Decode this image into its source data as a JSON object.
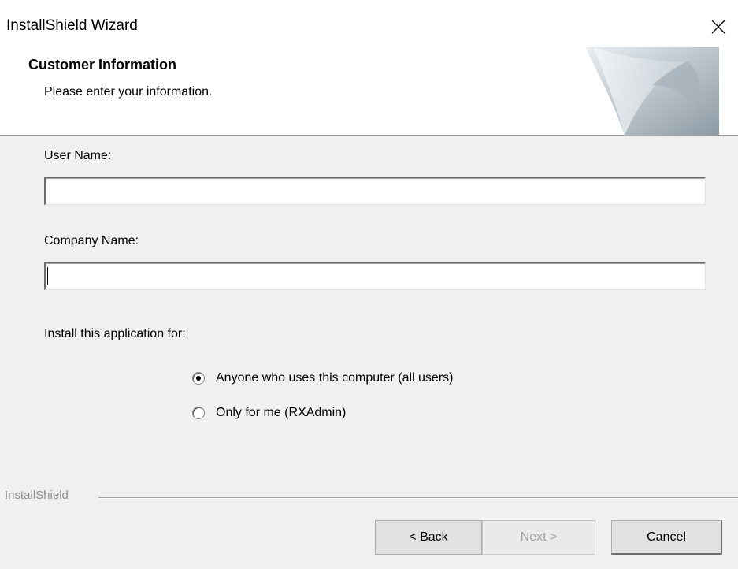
{
  "window": {
    "title": "InstallShield Wizard"
  },
  "header": {
    "title": "Customer Information",
    "subtitle": "Please enter your information."
  },
  "form": {
    "user_name_label": "User Name:",
    "user_name_value": "",
    "company_name_label": "Company Name:",
    "company_name_value": "",
    "install_for_label": "Install this application for:",
    "options": [
      {
        "label": "Anyone who uses this computer (all users)",
        "selected": true
      },
      {
        "label": "Only for me (RXAdmin)",
        "selected": false
      }
    ]
  },
  "footer": {
    "brand": "InstallShield",
    "back_label": "< Back",
    "next_label": "Next >",
    "cancel_label": "Cancel"
  },
  "icons": {
    "close": "close-icon",
    "banner": "page-curl-graphic"
  },
  "colors": {
    "background": "#f0f0f0",
    "header_bg": "#ffffff",
    "disabled_text": "#a0a0a0"
  }
}
